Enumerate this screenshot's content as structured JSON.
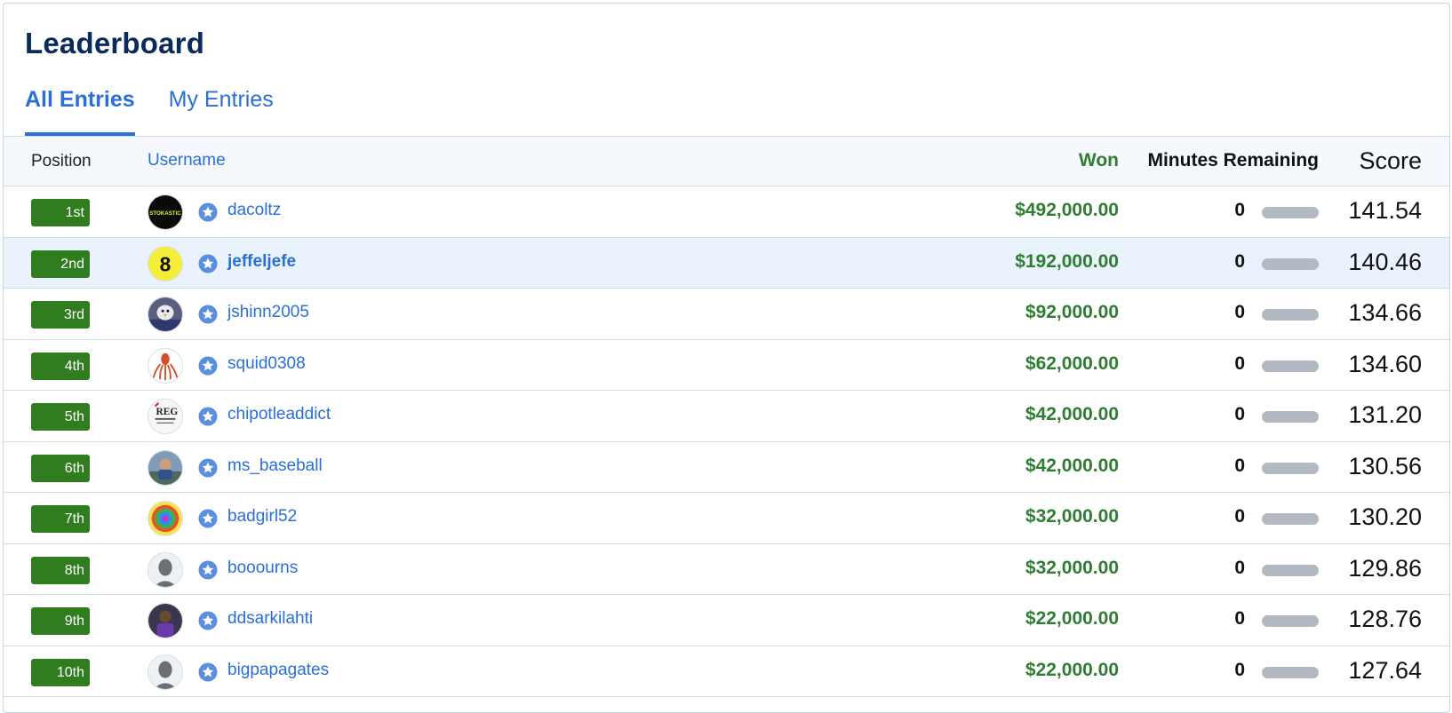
{
  "header": {
    "title": "Leaderboard"
  },
  "tabs": [
    {
      "label": "All Entries",
      "active": true
    },
    {
      "label": "My Entries",
      "active": false
    }
  ],
  "columns": {
    "position": "Position",
    "username": "Username",
    "won": "Won",
    "minutes": "Minutes Remaining",
    "score": "Score"
  },
  "colors": {
    "accent": "#2a6fd6",
    "badge": "#2f7d1f",
    "won": "#2e7d32",
    "highlight": "#eaf3fc"
  },
  "rows": [
    {
      "position": "1st",
      "username": "dacoltz",
      "won": "$492,000.00",
      "minutes": "0",
      "progress": 0,
      "score": "141.54",
      "avatar": "stoked-logo-avatar",
      "avatar_text": "STOKASTIC"
    },
    {
      "position": "2nd",
      "username": "jeffeljefe",
      "won": "$192,000.00",
      "minutes": "0",
      "progress": 0,
      "score": "140.46",
      "avatar": "eight-ball-avatar",
      "avatar_text": "8",
      "highlight": true
    },
    {
      "position": "3rd",
      "username": "jshinn2005",
      "won": "$92,000.00",
      "minutes": "0",
      "progress": 0,
      "score": "134.66",
      "avatar": "bird-mascot-avatar"
    },
    {
      "position": "4th",
      "username": "squid0308",
      "won": "$62,000.00",
      "minutes": "0",
      "progress": 0,
      "score": "134.60",
      "avatar": "squid-avatar"
    },
    {
      "position": "5th",
      "username": "chipotleaddict",
      "won": "$42,000.00",
      "minutes": "0",
      "progress": 0,
      "score": "131.20",
      "avatar": "text-logo-avatar",
      "avatar_text": "REG"
    },
    {
      "position": "6th",
      "username": "ms_baseball",
      "won": "$42,000.00",
      "minutes": "0",
      "progress": 0,
      "score": "130.56",
      "avatar": "photo-avatar"
    },
    {
      "position": "7th",
      "username": "badgirl52",
      "won": "$32,000.00",
      "minutes": "0",
      "progress": 0,
      "score": "130.20",
      "avatar": "tie-dye-avatar"
    },
    {
      "position": "8th",
      "username": "booourns",
      "won": "$32,000.00",
      "minutes": "0",
      "progress": 0,
      "score": "129.86",
      "avatar": "default-user-avatar"
    },
    {
      "position": "9th",
      "username": "ddsarkilahti",
      "won": "$22,000.00",
      "minutes": "0",
      "progress": 0,
      "score": "128.76",
      "avatar": "player-photo-avatar"
    },
    {
      "position": "10th",
      "username": "bigpapagates",
      "won": "$22,000.00",
      "minutes": "0",
      "progress": 0,
      "score": "127.64",
      "avatar": "default-user-avatar"
    }
  ]
}
